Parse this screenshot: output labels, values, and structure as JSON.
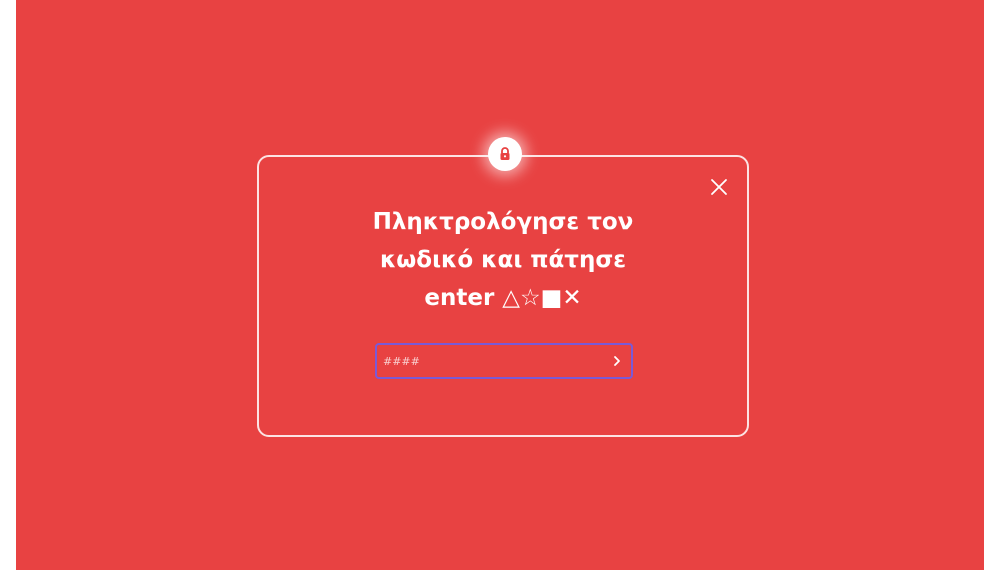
{
  "dialog": {
    "title_lines": [
      "Πληκτρολόγησε τον",
      "κωδικό και πάτησε",
      "enter △☆■✕"
    ],
    "code_input": {
      "value": "",
      "placeholder": "####"
    },
    "icons": {
      "lock": "lock-icon",
      "close": "close-icon",
      "submit": "chevron-right-icon"
    }
  },
  "colors": {
    "background": "#e84242",
    "text": "#ffffff",
    "input_border": "#7a5ad8",
    "lock_icon": "#e84242"
  }
}
